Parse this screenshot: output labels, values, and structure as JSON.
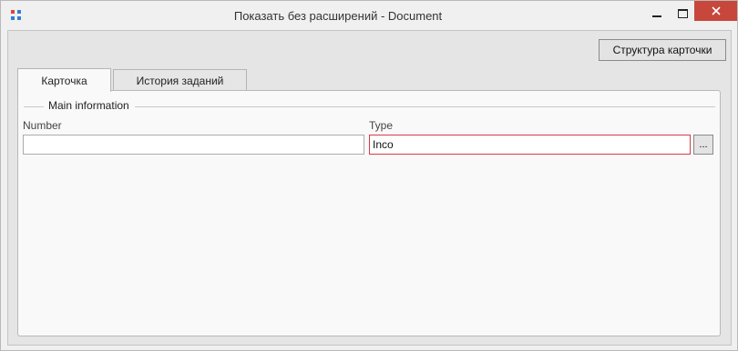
{
  "window": {
    "title": "Показать без расширений - Document"
  },
  "toolbar": {
    "structure_button": "Структура карточки"
  },
  "tabs": [
    {
      "label": "Карточка",
      "active": true
    },
    {
      "label": "История заданий",
      "active": false
    }
  ],
  "group": {
    "title": "Main information"
  },
  "fields": {
    "number": {
      "label": "Number",
      "value": ""
    },
    "type": {
      "label": "Type",
      "value": "Inco",
      "browse_label": "..."
    }
  },
  "colors": {
    "app_icon_red": "#e0433b",
    "app_icon_blue": "#2f7fd6",
    "close_button": "#c7473c",
    "invalid_border": "#d43c4a"
  }
}
